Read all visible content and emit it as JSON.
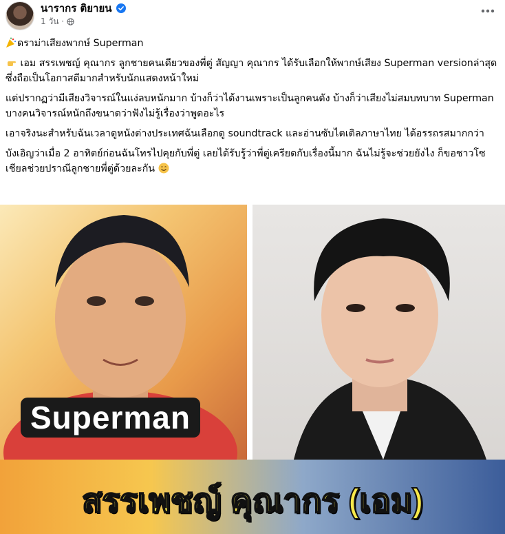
{
  "post": {
    "author": "นารากร ติยายน",
    "time": "1 วัน ·",
    "paragraphs": [
      "ดราม่าเสียงพากษ์ Superman",
      "เอม สรรเพชญ์ คุณากร ลูกชายคนเดียวของพี่ตู่ สัญญา คุณากร ได้รับเลือกให้พากษ์เสียง Superman versionล่าสุด ซึ่งถือเป็นโอกาสดีมากสำหรับนักแสดงหน้าใหม่",
      "แต่ปรากฏว่ามีเสียงวิจารณ์ในแง่ลบหนักมาก บ้างก็ว่าได้งานเพราะเป็นลูกคนดัง บ้างก็ว่าเสียงไม่สมบทบาท Superman บางคนวิจารณ์หนักถึงขนาดว่าฟังไม่รู้เรื่องว่าพูดอะไร",
      "เอาจริงนะสำหรับฉันเวลาดูหนังต่างประเทศฉันเลือกดู soundtrack และอ่านซับไตเติลภาษาไทย ได้อรรถรสมากกว่า",
      "บังเอิญว่าเมื่อ 2 อาทิตย์ก่อนฉันโทรไปคุยกับพี่ตู่ เลยได้รับรู้ว่าพี่ตู่เครียดกับเรื่องนี้มาก ฉันไม่รู้จะช่วยยังไง ก็ขอชาวโซเชียลช่วยปราณีลูกชายพี่ตู่ด้วยละกัน"
    ]
  },
  "image": {
    "left_label": "Superman",
    "banner_text": "สรรเพชญ์ คุณากร (เอม)"
  },
  "icons": {
    "more": "more-options-icon",
    "verified": "verified-badge-icon",
    "globe": "globe-icon",
    "party": "party-popper-icon",
    "point": "pointing-hand-icon",
    "smile": "smiling-face-icon"
  },
  "colors": {
    "verified": "#1877f2",
    "meta": "#65676b"
  }
}
